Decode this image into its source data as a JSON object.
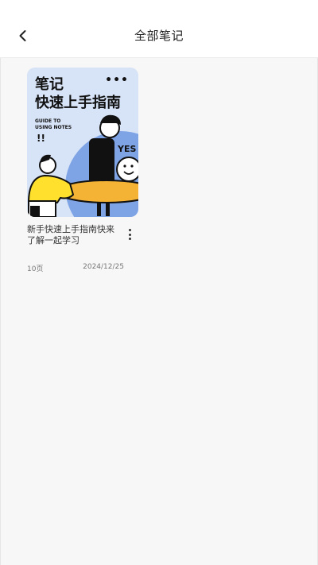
{
  "header": {
    "title": "全部笔记",
    "back_icon": "chevron-left-icon"
  },
  "notes": [
    {
      "cover": {
        "title_line1": "笔记",
        "title_line2": "快速上手指南",
        "subtitle_line1": "GUIDE TO",
        "subtitle_line2": "USING NOTES",
        "speech": "YES",
        "exclaim": "!!",
        "colors": {
          "background": "#d7e3f6",
          "table": "#f5b335",
          "shirt": "#ffe12d",
          "circle": "#7fa4e6"
        }
      },
      "title": "新手快速上手指南快来了解一起学习",
      "pages": "10页",
      "date": "2024/12/25",
      "more_icon": "more-vertical-icon"
    }
  ]
}
